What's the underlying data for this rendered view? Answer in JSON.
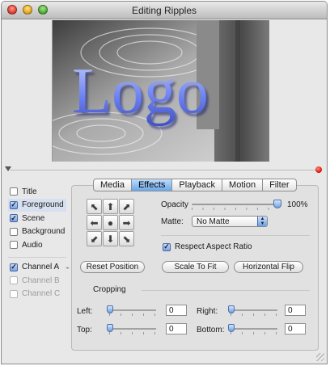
{
  "window": {
    "title": "Editing Ripples"
  },
  "preview": {
    "overlay_text": "Logo"
  },
  "layers": {
    "items": [
      {
        "label": "Title",
        "checked": false,
        "selected": false,
        "disabled": false
      },
      {
        "label": "Foreground",
        "checked": true,
        "selected": true,
        "disabled": false
      },
      {
        "label": "Scene",
        "checked": true,
        "selected": false,
        "disabled": false
      },
      {
        "label": "Background",
        "checked": false,
        "selected": false,
        "disabled": false
      },
      {
        "label": "Audio",
        "checked": false,
        "selected": false,
        "disabled": false
      }
    ],
    "channels": [
      {
        "label": "Channel A",
        "checked": true,
        "disabled": false
      },
      {
        "label": "Channel B",
        "checked": false,
        "disabled": true
      },
      {
        "label": "Channel C",
        "checked": false,
        "disabled": true
      }
    ]
  },
  "tabs": [
    {
      "label": "Media",
      "active": false
    },
    {
      "label": "Effects",
      "active": true
    },
    {
      "label": "Playback",
      "active": false
    },
    {
      "label": "Motion",
      "active": false
    },
    {
      "label": "Filter",
      "active": false
    }
  ],
  "effects": {
    "opacity_label": "Opacity",
    "opacity_value": "100%",
    "opacity_level": 1.0,
    "matte_label": "Matte:",
    "matte_value": "No Matte",
    "respect_aspect_label": "Respect Aspect Ratio",
    "respect_aspect_checked": true,
    "reset_position": "Reset Position",
    "scale_to_fit": "Scale To Fit",
    "horizontal_flip": "Horizontal Flip",
    "cropping": {
      "label": "Cropping",
      "left_label": "Left:",
      "left_value": "0",
      "right_label": "Right:",
      "right_value": "0",
      "top_label": "Top:",
      "top_value": "0",
      "bottom_label": "Bottom:",
      "bottom_value": "0"
    }
  },
  "colors": {
    "accent": "#6aa8ea",
    "logo": "#5a6fe0",
    "alert_dot": "#d11a0a"
  },
  "icons": {
    "disclosure": "triangle-down-icon",
    "alert": "red-dot-icon",
    "pin": "pin-icon",
    "position_pad": [
      "arrow-up-left-icon",
      "arrow-up-icon",
      "arrow-up-right-icon",
      "arrow-left-icon",
      "center-dot-icon",
      "arrow-right-icon",
      "arrow-down-left-icon",
      "arrow-down-icon",
      "arrow-down-right-icon"
    ]
  }
}
